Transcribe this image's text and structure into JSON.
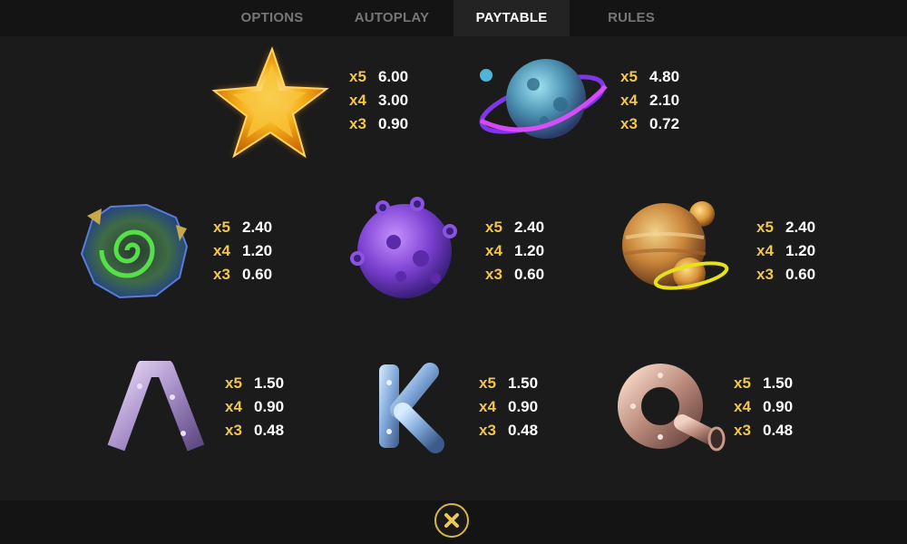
{
  "tabs": [
    {
      "label": "OPTIONS"
    },
    {
      "label": "AUTOPLAY"
    },
    {
      "label": "PAYTABLE"
    },
    {
      "label": "RULES"
    }
  ],
  "active_tab": "PAYTABLE",
  "symbols": [
    {
      "name": "star",
      "payouts": [
        {
          "mult": "x5",
          "value": "6.00"
        },
        {
          "mult": "x4",
          "value": "3.00"
        },
        {
          "mult": "x3",
          "value": "0.90"
        }
      ]
    },
    {
      "name": "ringed-planet",
      "payouts": [
        {
          "mult": "x5",
          "value": "4.80"
        },
        {
          "mult": "x4",
          "value": "2.10"
        },
        {
          "mult": "x3",
          "value": "0.72"
        }
      ]
    },
    {
      "name": "green-swirl-planet",
      "payouts": [
        {
          "mult": "x5",
          "value": "2.40"
        },
        {
          "mult": "x4",
          "value": "1.20"
        },
        {
          "mult": "x3",
          "value": "0.60"
        }
      ]
    },
    {
      "name": "purple-crater-moon",
      "payouts": [
        {
          "mult": "x5",
          "value": "2.40"
        },
        {
          "mult": "x4",
          "value": "1.20"
        },
        {
          "mult": "x3",
          "value": "0.60"
        }
      ]
    },
    {
      "name": "orange-planet-group",
      "payouts": [
        {
          "mult": "x5",
          "value": "2.40"
        },
        {
          "mult": "x4",
          "value": "1.20"
        },
        {
          "mult": "x3",
          "value": "0.60"
        }
      ]
    },
    {
      "name": "letter-a",
      "payouts": [
        {
          "mult": "x5",
          "value": "1.50"
        },
        {
          "mult": "x4",
          "value": "0.90"
        },
        {
          "mult": "x3",
          "value": "0.48"
        }
      ]
    },
    {
      "name": "letter-k",
      "payouts": [
        {
          "mult": "x5",
          "value": "1.50"
        },
        {
          "mult": "x4",
          "value": "0.90"
        },
        {
          "mult": "x3",
          "value": "0.48"
        }
      ]
    },
    {
      "name": "letter-q",
      "payouts": [
        {
          "mult": "x5",
          "value": "1.50"
        },
        {
          "mult": "x4",
          "value": "0.90"
        },
        {
          "mult": "x3",
          "value": "0.48"
        }
      ]
    }
  ],
  "close_icon": "close-icon",
  "colors": {
    "multiplier": "#f2c64b",
    "value": "#ffffff",
    "accent": "#d6b54a"
  }
}
